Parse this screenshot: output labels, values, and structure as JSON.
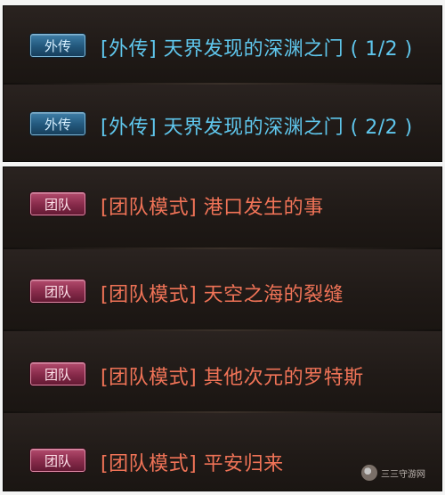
{
  "quests": [
    {
      "tag": "外传",
      "title": "[外传] 天界发现的深渊之门 ( 1/2 )",
      "style": "blue"
    },
    {
      "tag": "外传",
      "title": "[外传] 天界发现的深渊之门 ( 2/2 )",
      "style": "blue"
    },
    {
      "tag": "团队",
      "title": "[团队模式] 港口发生的事",
      "style": "red"
    },
    {
      "tag": "团队",
      "title": "[团队模式] 天空之海的裂缝",
      "style": "red"
    },
    {
      "tag": "团队",
      "title": "[团队模式] 其他次元的罗特斯",
      "style": "red"
    },
    {
      "tag": "团队",
      "title": "[团队模式] 平安归来",
      "style": "red"
    }
  ],
  "watermark": {
    "text": "三三守游网"
  },
  "colors": {
    "panel": "#1d1815",
    "blue_text": "#5fc6ec",
    "red_text": "#f07357"
  }
}
